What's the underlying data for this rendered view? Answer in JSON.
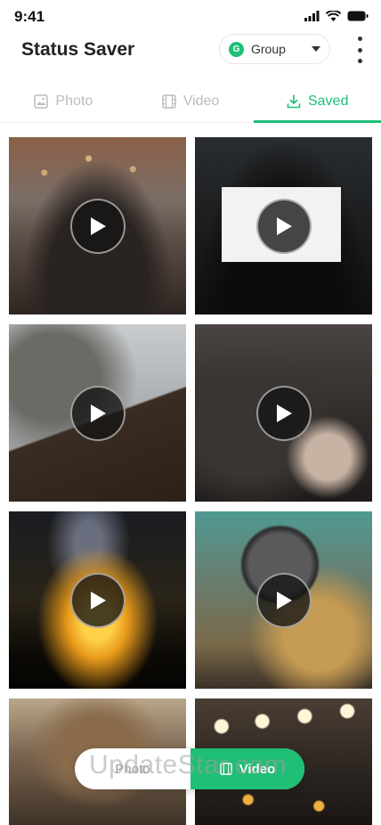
{
  "status": {
    "time": "9:41"
  },
  "header": {
    "title": "Status Saver",
    "group": {
      "badge": "G",
      "label": "Group"
    }
  },
  "tabs": [
    {
      "label": "Photo",
      "icon": "image-icon",
      "active": false
    },
    {
      "label": "Video",
      "icon": "film-icon",
      "active": false
    },
    {
      "label": "Saved",
      "icon": "download-icon",
      "active": true
    }
  ],
  "videos": [
    {
      "theme": "crowd-party"
    },
    {
      "theme": "conference-screen"
    },
    {
      "theme": "meeting-table"
    },
    {
      "theme": "audience-seated"
    },
    {
      "theme": "concert-lights"
    },
    {
      "theme": "microphone"
    },
    {
      "theme": "ornate-hall"
    },
    {
      "theme": "bokeh-lights"
    }
  ],
  "floating_toggle": {
    "left_label": "Photo",
    "right_label": "Video"
  },
  "watermark": "UpdateStar.com",
  "colors": {
    "accent": "#1fbf75",
    "text": "#222222",
    "inactive": "#b9bcc0"
  }
}
